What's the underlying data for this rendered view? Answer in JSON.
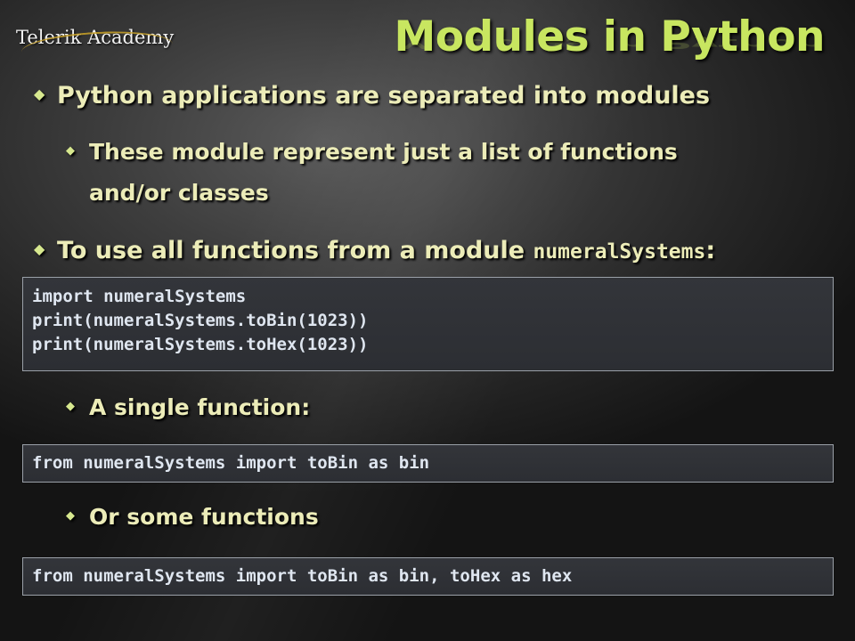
{
  "brand": {
    "logo_text": "Telerik Academy"
  },
  "slide": {
    "title": "Modules in Python",
    "bullets": [
      {
        "text": "Python applications are separated into modules"
      },
      {
        "line1": "These module represent just a list of functions",
        "line2": "and/or classes"
      },
      {
        "text": "To use all functions from a module ",
        "code": "numeralSystems",
        "suffix": ":"
      },
      {
        "text": "A single function:"
      },
      {
        "text": "Or some functions"
      }
    ],
    "code_blocks": [
      {
        "lines": [
          "import numeralSystems",
          "print(numeralSystems.toBin(1023))",
          "print(numeralSystems.toHex(1023))"
        ]
      },
      {
        "lines": [
          "from numeralSystems import toBin as bin"
        ]
      },
      {
        "lines": [
          "from numeralSystems import toBin as bin, toHex as hex"
        ]
      }
    ]
  },
  "icons": {
    "bullet_level1": "diamond-bullet-icon",
    "bullet_level2": "small-diamond-bullet-icon"
  },
  "colors": {
    "title": "#c8e660",
    "bullet_text": "#ececb8",
    "code_text": "#dfe6f0",
    "code_border": "#9aa0a8"
  }
}
